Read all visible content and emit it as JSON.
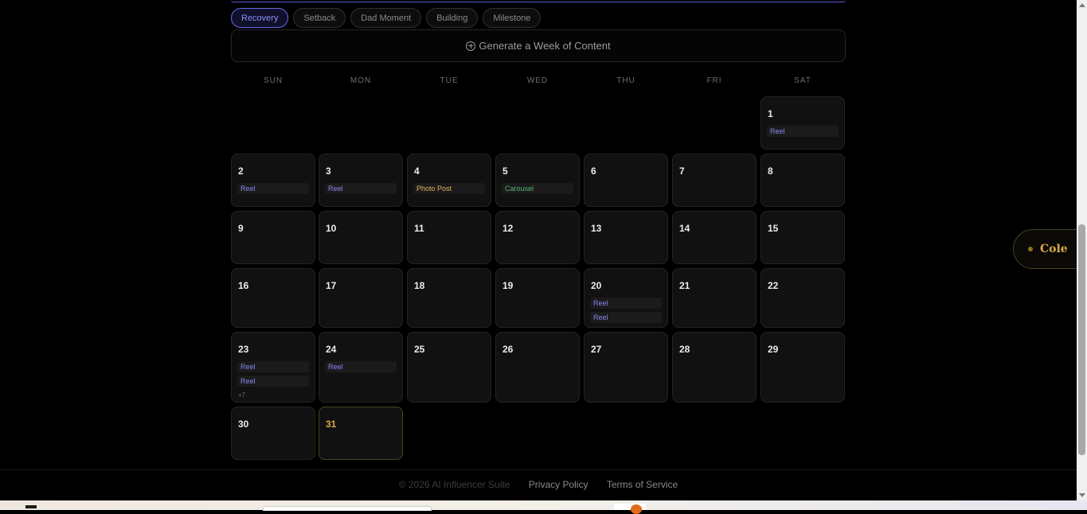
{
  "filters": [
    "Recovery",
    "Setback",
    "Dad Moment",
    "Building",
    "Milestone"
  ],
  "generate_label": "Generate a Week of Content",
  "weekdays": [
    "SUN",
    "MON",
    "TUE",
    "WED",
    "THU",
    "FRI",
    "SAT"
  ],
  "days": [
    {
      "num": "1",
      "posts": [
        {
          "type": "reel",
          "label": "Reel"
        }
      ]
    },
    {
      "num": "2",
      "posts": [
        {
          "type": "reel",
          "label": "Reel"
        }
      ]
    },
    {
      "num": "3",
      "posts": [
        {
          "type": "reel",
          "label": "Reel"
        }
      ]
    },
    {
      "num": "4",
      "posts": [
        {
          "type": "photo",
          "label": "Photo Post"
        }
      ]
    },
    {
      "num": "5",
      "posts": [
        {
          "type": "carousel",
          "label": "Carousel"
        }
      ]
    },
    {
      "num": "6",
      "posts": []
    },
    {
      "num": "7",
      "posts": []
    },
    {
      "num": "8",
      "posts": []
    },
    {
      "num": "9",
      "posts": []
    },
    {
      "num": "10",
      "posts": []
    },
    {
      "num": "11",
      "posts": []
    },
    {
      "num": "12",
      "posts": []
    },
    {
      "num": "13",
      "posts": []
    },
    {
      "num": "14",
      "posts": []
    },
    {
      "num": "15",
      "posts": []
    },
    {
      "num": "16",
      "posts": []
    },
    {
      "num": "17",
      "posts": []
    },
    {
      "num": "18",
      "posts": []
    },
    {
      "num": "19",
      "posts": []
    },
    {
      "num": "20",
      "posts": [
        {
          "type": "reel",
          "label": "Reel"
        },
        {
          "type": "reel",
          "label": "Reel"
        }
      ]
    },
    {
      "num": "21",
      "posts": []
    },
    {
      "num": "22",
      "posts": []
    },
    {
      "num": "23",
      "posts": [
        {
          "type": "reel",
          "label": "Reel"
        },
        {
          "type": "reel",
          "label": "Reel"
        }
      ],
      "more": "+7"
    },
    {
      "num": "24",
      "posts": [
        {
          "type": "reel",
          "label": "Reel"
        }
      ]
    },
    {
      "num": "25",
      "posts": []
    },
    {
      "num": "26",
      "posts": []
    },
    {
      "num": "27",
      "posts": []
    },
    {
      "num": "28",
      "posts": []
    },
    {
      "num": "29",
      "posts": []
    },
    {
      "num": "30",
      "posts": []
    },
    {
      "num": "31",
      "posts": [],
      "today": true
    }
  ],
  "footer": {
    "copyright": "© 2026 AI Influencer Suite",
    "privacy": "Privacy Policy",
    "terms": "Terms of Service"
  },
  "side_badge": {
    "name": "Cole"
  }
}
